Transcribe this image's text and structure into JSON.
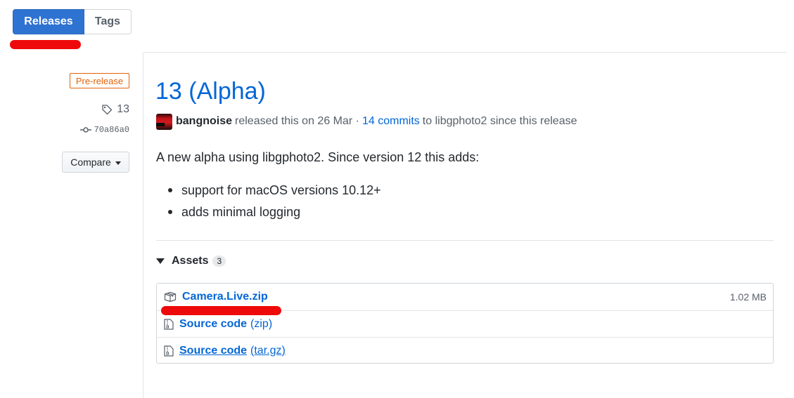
{
  "tabs": {
    "releases_label": "Releases",
    "tags_label": "Tags"
  },
  "sidebar": {
    "badge": "Pre-release",
    "tag": "13",
    "commit": "70a86a0",
    "compare_label": "Compare"
  },
  "release": {
    "title": "13 (Alpha)",
    "author": "bangnoise",
    "released_text": "released this on 26 Mar ·",
    "commits_link": "14 commits",
    "commits_suffix": "to libgphoto2 since this release",
    "description": "A new alpha using libgphoto2. Since version 12 this adds:",
    "bullets": [
      "support for macOS versions 10.12+",
      "adds minimal logging"
    ]
  },
  "assets": {
    "label": "Assets",
    "count": "3",
    "items": [
      {
        "name": "Camera.Live.zip",
        "size": "1.02 MB"
      },
      {
        "name": "Source code",
        "suffix": "(zip)"
      },
      {
        "name": "Source code",
        "suffix": "(tar.gz)"
      }
    ]
  },
  "colors": {
    "link": "#0366d6",
    "accent": "#2f73d2",
    "prerelease": "#e36209",
    "annotation": "#ee0a0a"
  },
  "icons": [
    "tag-icon",
    "git-commit-icon",
    "package-icon",
    "file-zip-icon",
    "caret-down-icon",
    "triangle-down-icon"
  ]
}
